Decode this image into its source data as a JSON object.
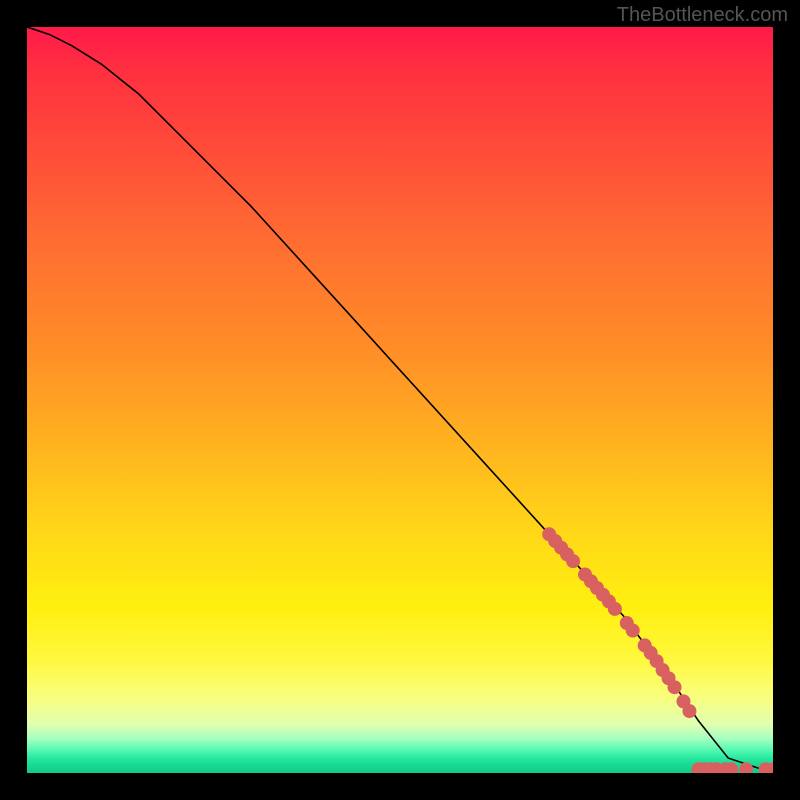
{
  "watermark": "TheBottleneck.com",
  "chart_data": {
    "type": "line",
    "title": "",
    "xlabel": "",
    "ylabel": "",
    "xlim": [
      0,
      100
    ],
    "ylim": [
      0,
      100
    ],
    "curve": {
      "name": "main-curve",
      "x": [
        0,
        3,
        6,
        10,
        15,
        20,
        30,
        40,
        50,
        60,
        70,
        80,
        86,
        90,
        94,
        100
      ],
      "y": [
        100,
        99,
        97.5,
        95,
        91,
        86,
        76,
        65,
        54,
        43,
        32,
        21,
        13,
        7,
        2,
        0
      ]
    },
    "highlight_series": {
      "name": "red-markers",
      "color": "#d86060",
      "points": [
        {
          "x": 70,
          "y": 32
        },
        {
          "x": 70.8,
          "y": 31.1
        },
        {
          "x": 71.6,
          "y": 30.2
        },
        {
          "x": 72.4,
          "y": 29.3
        },
        {
          "x": 73.2,
          "y": 28.4
        },
        {
          "x": 74.8,
          "y": 26.6
        },
        {
          "x": 75.6,
          "y": 25.7
        },
        {
          "x": 76.4,
          "y": 24.8
        },
        {
          "x": 77.2,
          "y": 23.9
        },
        {
          "x": 78,
          "y": 23
        },
        {
          "x": 78.8,
          "y": 22
        },
        {
          "x": 80.4,
          "y": 20.1
        },
        {
          "x": 81.2,
          "y": 19.1
        },
        {
          "x": 82.8,
          "y": 17.1
        },
        {
          "x": 83.6,
          "y": 16.1
        },
        {
          "x": 84.4,
          "y": 15
        },
        {
          "x": 85.2,
          "y": 13.8
        },
        {
          "x": 86,
          "y": 12.7
        },
        {
          "x": 86.8,
          "y": 11.5
        },
        {
          "x": 88,
          "y": 9.6
        },
        {
          "x": 88.8,
          "y": 8.3
        },
        {
          "x": 90,
          "y": 0.5
        },
        {
          "x": 90.8,
          "y": 0.5
        },
        {
          "x": 91.6,
          "y": 0.5
        },
        {
          "x": 92.4,
          "y": 0.5
        },
        {
          "x": 93.6,
          "y": 0.5
        },
        {
          "x": 94.4,
          "y": 0.5
        },
        {
          "x": 96.4,
          "y": 0.5
        },
        {
          "x": 99,
          "y": 0.5
        },
        {
          "x": 100,
          "y": 0.5
        }
      ]
    }
  }
}
